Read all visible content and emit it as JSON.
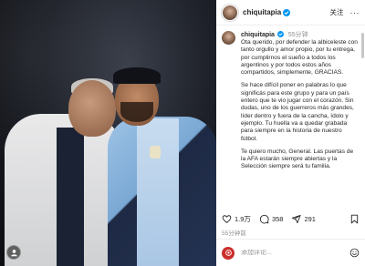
{
  "post": {
    "username": "chiquitapia",
    "follow_label": "关注",
    "more_label": "···",
    "time_ago": "55分钟",
    "caption_paragraphs": [
      "Ota querido, por defender la albiceleste con tanto orgullo y amor propio, por tu entrega, por cumplirnos el sueño a todos los argentinos y por todos estos años compartidos, simplemente, GRACIAS.",
      "Se hace difícil poner en palabras lo que significás para este grupo y para un país entero que te vio jugar con el corazón. Sin dudas, uno de los guerreros más grandes, líder dentro y fuera de la cancha, ídolo y ejemplo. Tu huella va a quedar grabada para siempre en la historia de nuestro fútbol.",
      "Te quiero mucho, General. Las puertas de la AFA estarán siempre abiertas y la Selección siempre será tu familia."
    ]
  },
  "actions": {
    "likes": "1.9万",
    "comments": "358",
    "shares": "291"
  },
  "timestamp": "55分钟前",
  "comment": {
    "placeholder": "添加评论..."
  },
  "icons": {
    "verified": "verified-badge-icon",
    "like": "heart-icon",
    "comment": "comment-bubble-icon",
    "share": "paper-plane-icon",
    "save": "bookmark-icon",
    "emoji": "smiley-icon",
    "tag": "user-tag-icon"
  },
  "colors": {
    "verified": "#0095f6",
    "text": "#262626",
    "muted": "#8e8e8e"
  }
}
